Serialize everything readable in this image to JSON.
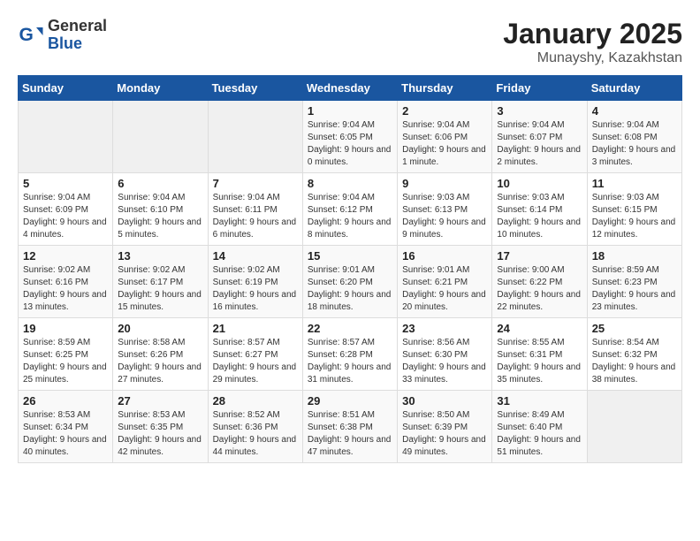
{
  "header": {
    "logo_general": "General",
    "logo_blue": "Blue",
    "month_title": "January 2025",
    "location": "Munayshy, Kazakhstan"
  },
  "weekdays": [
    "Sunday",
    "Monday",
    "Tuesday",
    "Wednesday",
    "Thursday",
    "Friday",
    "Saturday"
  ],
  "weeks": [
    [
      {
        "day": "",
        "empty": true
      },
      {
        "day": "",
        "empty": true
      },
      {
        "day": "",
        "empty": true
      },
      {
        "day": "1",
        "sunrise": "9:04 AM",
        "sunset": "6:05 PM",
        "daylight": "9 hours and 0 minutes."
      },
      {
        "day": "2",
        "sunrise": "9:04 AM",
        "sunset": "6:06 PM",
        "daylight": "9 hours and 1 minute."
      },
      {
        "day": "3",
        "sunrise": "9:04 AM",
        "sunset": "6:07 PM",
        "daylight": "9 hours and 2 minutes."
      },
      {
        "day": "4",
        "sunrise": "9:04 AM",
        "sunset": "6:08 PM",
        "daylight": "9 hours and 3 minutes."
      }
    ],
    [
      {
        "day": "5",
        "sunrise": "9:04 AM",
        "sunset": "6:09 PM",
        "daylight": "9 hours and 4 minutes."
      },
      {
        "day": "6",
        "sunrise": "9:04 AM",
        "sunset": "6:10 PM",
        "daylight": "9 hours and 5 minutes."
      },
      {
        "day": "7",
        "sunrise": "9:04 AM",
        "sunset": "6:11 PM",
        "daylight": "9 hours and 6 minutes."
      },
      {
        "day": "8",
        "sunrise": "9:04 AM",
        "sunset": "6:12 PM",
        "daylight": "9 hours and 8 minutes."
      },
      {
        "day": "9",
        "sunrise": "9:03 AM",
        "sunset": "6:13 PM",
        "daylight": "9 hours and 9 minutes."
      },
      {
        "day": "10",
        "sunrise": "9:03 AM",
        "sunset": "6:14 PM",
        "daylight": "9 hours and 10 minutes."
      },
      {
        "day": "11",
        "sunrise": "9:03 AM",
        "sunset": "6:15 PM",
        "daylight": "9 hours and 12 minutes."
      }
    ],
    [
      {
        "day": "12",
        "sunrise": "9:02 AM",
        "sunset": "6:16 PM",
        "daylight": "9 hours and 13 minutes."
      },
      {
        "day": "13",
        "sunrise": "9:02 AM",
        "sunset": "6:17 PM",
        "daylight": "9 hours and 15 minutes."
      },
      {
        "day": "14",
        "sunrise": "9:02 AM",
        "sunset": "6:19 PM",
        "daylight": "9 hours and 16 minutes."
      },
      {
        "day": "15",
        "sunrise": "9:01 AM",
        "sunset": "6:20 PM",
        "daylight": "9 hours and 18 minutes."
      },
      {
        "day": "16",
        "sunrise": "9:01 AM",
        "sunset": "6:21 PM",
        "daylight": "9 hours and 20 minutes."
      },
      {
        "day": "17",
        "sunrise": "9:00 AM",
        "sunset": "6:22 PM",
        "daylight": "9 hours and 22 minutes."
      },
      {
        "day": "18",
        "sunrise": "8:59 AM",
        "sunset": "6:23 PM",
        "daylight": "9 hours and 23 minutes."
      }
    ],
    [
      {
        "day": "19",
        "sunrise": "8:59 AM",
        "sunset": "6:25 PM",
        "daylight": "9 hours and 25 minutes."
      },
      {
        "day": "20",
        "sunrise": "8:58 AM",
        "sunset": "6:26 PM",
        "daylight": "9 hours and 27 minutes."
      },
      {
        "day": "21",
        "sunrise": "8:57 AM",
        "sunset": "6:27 PM",
        "daylight": "9 hours and 29 minutes."
      },
      {
        "day": "22",
        "sunrise": "8:57 AM",
        "sunset": "6:28 PM",
        "daylight": "9 hours and 31 minutes."
      },
      {
        "day": "23",
        "sunrise": "8:56 AM",
        "sunset": "6:30 PM",
        "daylight": "9 hours and 33 minutes."
      },
      {
        "day": "24",
        "sunrise": "8:55 AM",
        "sunset": "6:31 PM",
        "daylight": "9 hours and 35 minutes."
      },
      {
        "day": "25",
        "sunrise": "8:54 AM",
        "sunset": "6:32 PM",
        "daylight": "9 hours and 38 minutes."
      }
    ],
    [
      {
        "day": "26",
        "sunrise": "8:53 AM",
        "sunset": "6:34 PM",
        "daylight": "9 hours and 40 minutes."
      },
      {
        "day": "27",
        "sunrise": "8:53 AM",
        "sunset": "6:35 PM",
        "daylight": "9 hours and 42 minutes."
      },
      {
        "day": "28",
        "sunrise": "8:52 AM",
        "sunset": "6:36 PM",
        "daylight": "9 hours and 44 minutes."
      },
      {
        "day": "29",
        "sunrise": "8:51 AM",
        "sunset": "6:38 PM",
        "daylight": "9 hours and 47 minutes."
      },
      {
        "day": "30",
        "sunrise": "8:50 AM",
        "sunset": "6:39 PM",
        "daylight": "9 hours and 49 minutes."
      },
      {
        "day": "31",
        "sunrise": "8:49 AM",
        "sunset": "6:40 PM",
        "daylight": "9 hours and 51 minutes."
      },
      {
        "day": "",
        "empty": true
      }
    ]
  ]
}
